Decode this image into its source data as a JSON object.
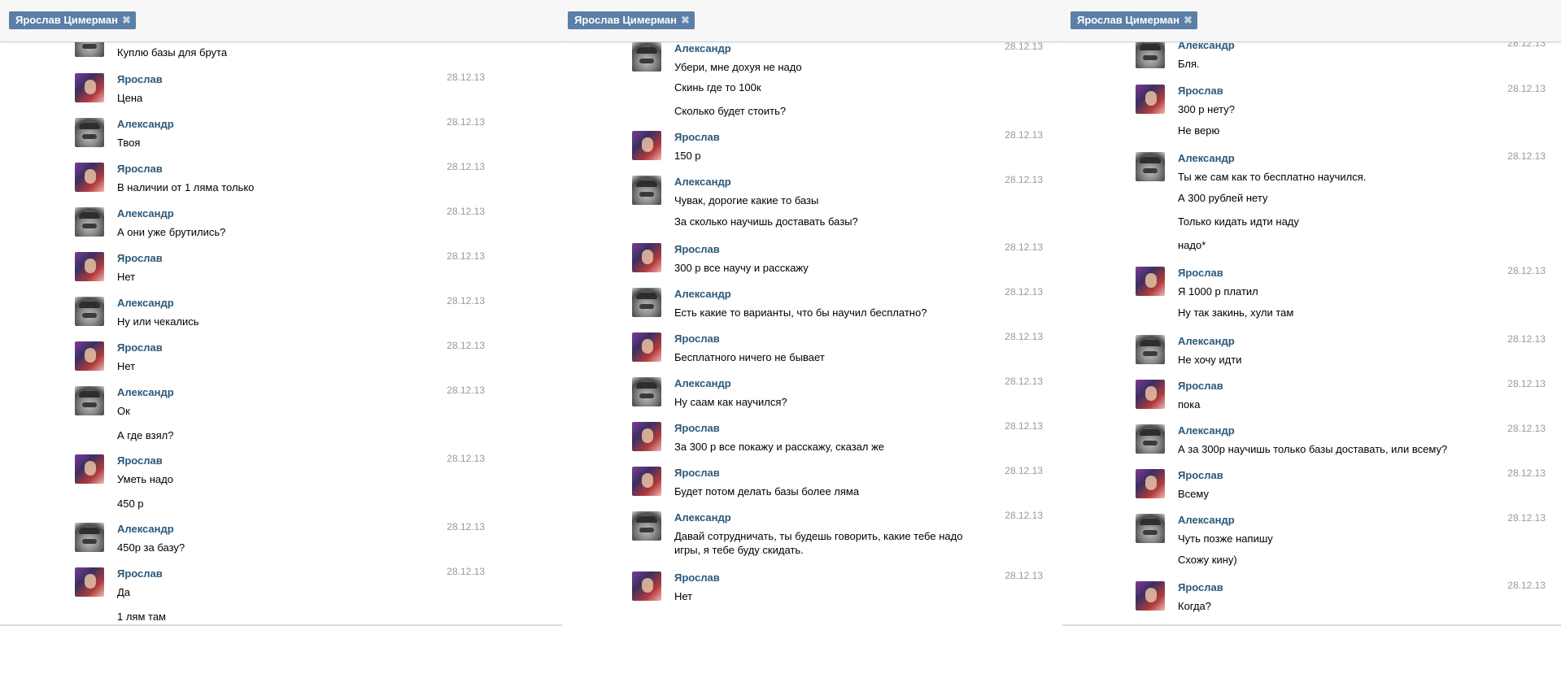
{
  "tab_label": "Ярослав Цимерман",
  "close_glyph": "✖",
  "senders": {
    "a": "Александр",
    "y": "Ярослав"
  },
  "date": "28.12.13",
  "panel1": {
    "m1": "Куплю базы для брута",
    "m2": "Цена",
    "m3": "Твоя",
    "m4": "В наличии от 1 ляма только",
    "m5": "А они уже брутились?",
    "m6": "Нет",
    "m7": "Ну или чекались",
    "m8": "Нет",
    "m9": "Ок",
    "m9b": "А где взял?",
    "m10": "Уметь надо",
    "m10b": "450 р",
    "m11": "450р за базу?",
    "m12": "Да",
    "m12b": "1 лям там"
  },
  "panel2": {
    "m1": "Убери, мне дохуя не надо",
    "m1b": "Скинь где то 100к",
    "m1c": "Сколько будет стоить?",
    "m2": "150 р",
    "m3": "Чувак, дорогие какие то базы",
    "m3b": "За сколько научишь доставать базы?",
    "m4": "300 р все научу и расскажу",
    "m5": "Есть какие то варианты, что бы научил бесплатно?",
    "m6": "Бесплатного ничего не бывает",
    "m7": "Ну саам как научился?",
    "m8": "За 300 р все покажу и расскажу, сказал же",
    "m9": "Будет потом делать базы более ляма",
    "m10": "Давай сотрудничать, ты будешь говорить, какие тебе надо",
    "m10b": "игры, я тебе буду скидать.",
    "m11": "Нет"
  },
  "panel3": {
    "m1": "Бля.",
    "m2": "300 р нету?",
    "m2b": "Не верю",
    "m3": "Ты же сам как то бесплатно научился.",
    "m3b": "А 300 рублей нету",
    "m3c": "Только кидать идти наду",
    "m3d": "надо*",
    "m4": "Я 1000 р платил",
    "m4b": "Ну так закинь, хули там",
    "m5": "Не хочу идти",
    "m6": "пока",
    "m7": "А за 300р научишь только базы доставать, или всему?",
    "m8": "Всему",
    "m9": "Чуть позже напишу",
    "m9b": "Схожу кину)",
    "m10": "Когда?"
  }
}
